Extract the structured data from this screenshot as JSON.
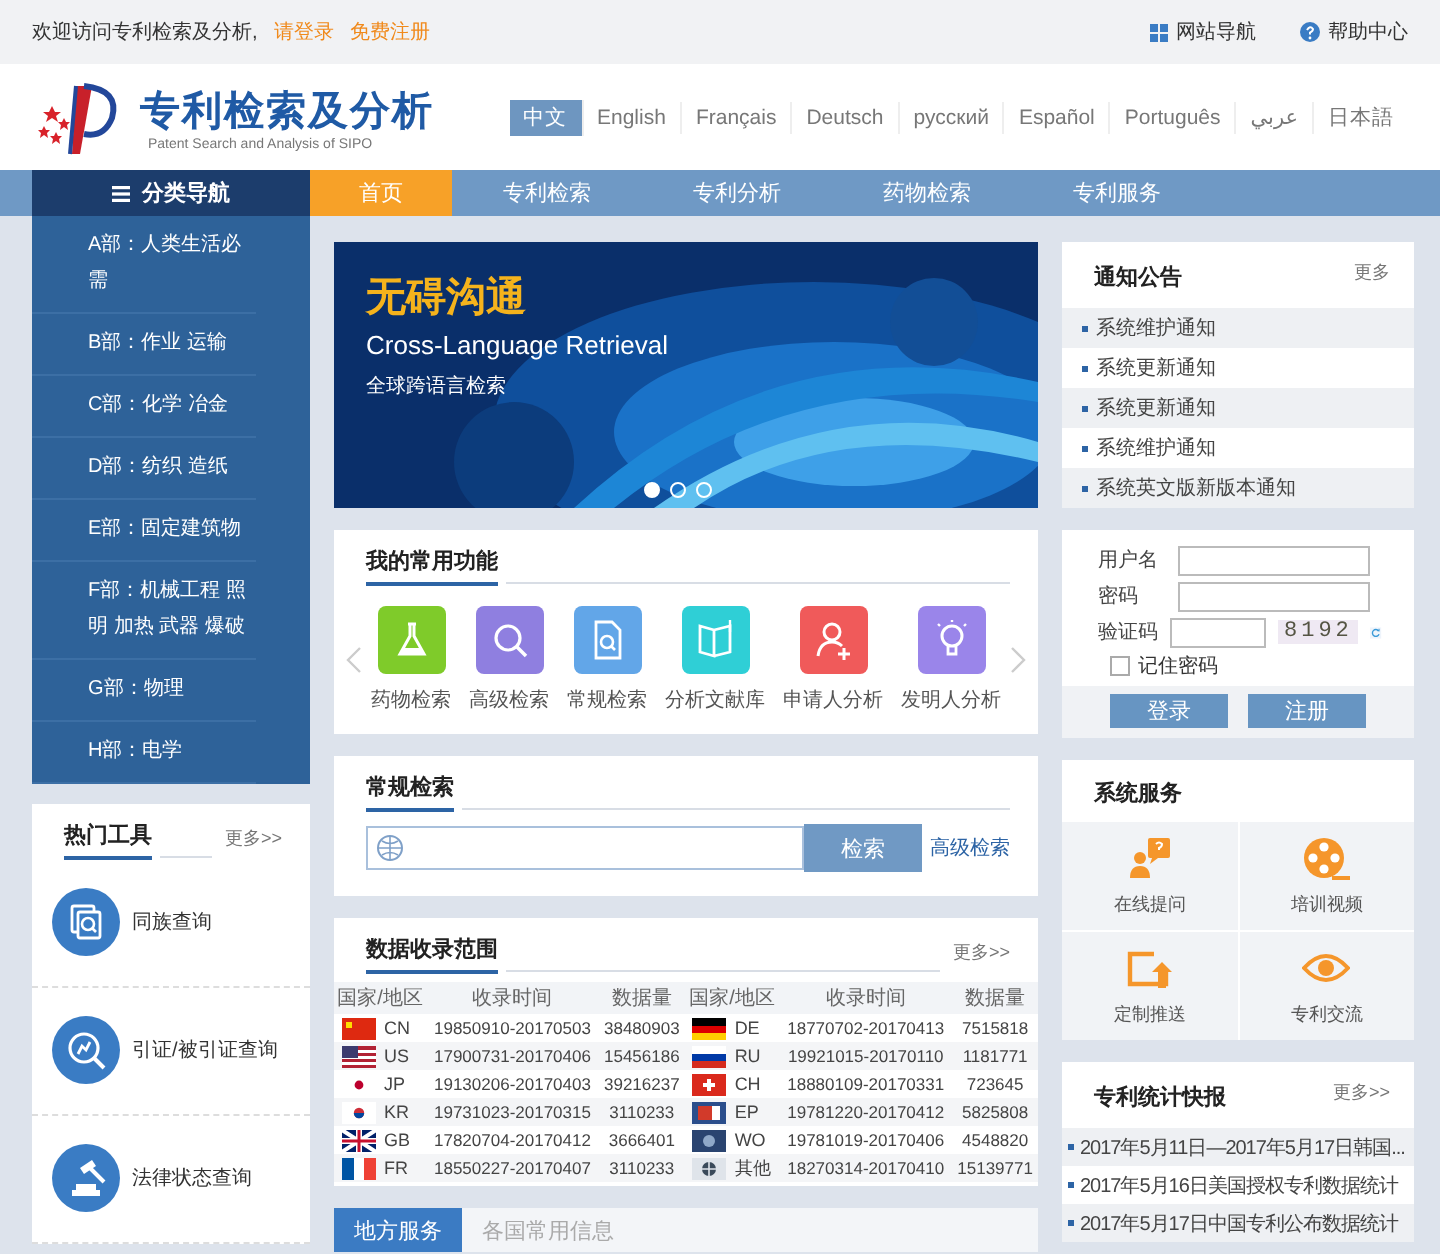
{
  "top_bar": {
    "welcome": "欢迎访问专利检索及分析,",
    "login_link": "请登录",
    "register_link": "免费注册",
    "links": [
      {
        "label": "网站导航",
        "kind": "grid"
      },
      {
        "label": "帮助中心",
        "kind": "help"
      }
    ]
  },
  "header": {
    "title": "专利检索及分析",
    "subtitle": "Patent Search and Analysis of SIPO",
    "languages": [
      {
        "label": "中文",
        "selected": true
      },
      {
        "label": "English",
        "selected": false
      },
      {
        "label": "Français",
        "selected": false
      },
      {
        "label": "Deutsch",
        "selected": false
      },
      {
        "label": "русский",
        "selected": false
      },
      {
        "label": "Español",
        "selected": false
      },
      {
        "label": "Português",
        "selected": false
      },
      {
        "label": "عربي",
        "selected": false
      },
      {
        "label": "日本語",
        "selected": false
      }
    ]
  },
  "nav": {
    "category_title": "分类导航",
    "items": [
      {
        "label": "首页",
        "selected": true
      },
      {
        "label": "专利检索",
        "selected": false
      },
      {
        "label": "专利分析",
        "selected": false
      },
      {
        "label": "药物检索",
        "selected": false
      },
      {
        "label": "专利服务",
        "selected": false
      }
    ]
  },
  "categories": [
    "A部：人类生活必需",
    "B部：作业 运输",
    "C部：化学 冶金",
    "D部：纺织 造纸",
    "E部：固定建筑物",
    "F部：机械工程 照明 加热 武器 爆破",
    "G部：物理",
    "H部：电学"
  ],
  "hot_tools": {
    "title": "热门工具",
    "more": "更多>>",
    "items": [
      {
        "label": "同族查询",
        "kind": "family"
      },
      {
        "label": "引证/被引证查询",
        "kind": "citation"
      },
      {
        "label": "法律状态查询",
        "kind": "law"
      }
    ]
  },
  "banner": {
    "title": "无碍沟通",
    "subtitle": "Cross-Language Retrieval",
    "caption": "全球跨语言检索",
    "dots": [
      {
        "selected": true
      },
      {
        "selected": false
      },
      {
        "selected": false
      }
    ]
  },
  "functions": {
    "title": "我的常用功能",
    "items": [
      {
        "label": "药物检索",
        "kind": "flask",
        "color": "#7fcb2a"
      },
      {
        "label": "高级检索",
        "kind": "search",
        "color": "#8f7fe0"
      },
      {
        "label": "常规检索",
        "kind": "document",
        "color": "#62a6e8"
      },
      {
        "label": "分析文献库",
        "kind": "book",
        "color": "#2fcfd6"
      },
      {
        "label": "申请人分析",
        "kind": "person",
        "color": "#f05a5a"
      },
      {
        "label": "发明人分析",
        "kind": "bulb",
        "color": "#9a85ea"
      }
    ]
  },
  "search": {
    "title": "常规检索",
    "button": "检索",
    "advanced_link": "高级检索"
  },
  "coverage": {
    "title": "数据收录范围",
    "more": "更多>>",
    "columns": [
      "国家/地区",
      "收录时间",
      "数据量",
      "国家/地区",
      "收录时间",
      "数据量"
    ],
    "rows": [
      [
        {
          "kind": "cn",
          "code": "CN",
          "range": "19850910-20170503",
          "count": "38480903"
        },
        {
          "kind": "de",
          "code": "DE",
          "range": "18770702-20170413",
          "count": "7515818"
        }
      ],
      [
        {
          "kind": "us",
          "code": "US",
          "range": "17900731-20170406",
          "count": "15456186"
        },
        {
          "kind": "ru",
          "code": "RU",
          "range": "19921015-20170110",
          "count": "1181771"
        }
      ],
      [
        {
          "kind": "jp",
          "code": "JP",
          "range": "19130206-20170403",
          "count": "39216237"
        },
        {
          "kind": "ch",
          "code": "CH",
          "range": "18880109-20170331",
          "count": "723645"
        }
      ],
      [
        {
          "kind": "kr",
          "code": "KR",
          "range": "19731023-20170315",
          "count": "3110233"
        },
        {
          "kind": "ep",
          "code": "EP",
          "range": "19781220-20170412",
          "count": "5825808"
        }
      ],
      [
        {
          "kind": "gb",
          "code": "GB",
          "range": "17820704-20170412",
          "count": "3666401"
        },
        {
          "kind": "wo",
          "code": "WO",
          "range": "19781019-20170406",
          "count": "4548820"
        }
      ],
      [
        {
          "kind": "fr",
          "code": "FR",
          "range": "18550227-20170407",
          "count": "3110233"
        },
        {
          "kind": "other",
          "code": "其他",
          "range": "18270314-20170410",
          "count": "15139771"
        }
      ]
    ]
  },
  "local_tabs": [
    {
      "label": "地方服务",
      "selected": true
    },
    {
      "label": "各国常用信息",
      "selected": false
    }
  ],
  "notices": {
    "title": "通知公告",
    "more": "更多",
    "items": [
      "系统维护通知",
      "系统更新通知",
      "系统更新通知",
      "系统维护通知",
      "系统英文版新版本通知"
    ]
  },
  "login": {
    "username_label": "用户名",
    "password_label": "密码",
    "captcha_label": "验证码",
    "captcha": "8192",
    "remember": {
      "label": "记住密码",
      "checked": false
    },
    "login_button": "登录",
    "register_button": "注册"
  },
  "services": {
    "title": "系统服务",
    "items": [
      {
        "label": "在线提问",
        "kind": "question"
      },
      {
        "label": "培训视频",
        "kind": "film"
      },
      {
        "label": "定制推送",
        "kind": "push"
      },
      {
        "label": "专利交流",
        "kind": "eye"
      }
    ]
  },
  "stats": {
    "title": "专利统计快报",
    "more": "更多>>",
    "items": [
      "2017年5月11日—2017年5月17日韩国...",
      "2017年5月16日美国授权专利数据统计",
      "2017年5月17日中国专利公布数据统计"
    ]
  }
}
